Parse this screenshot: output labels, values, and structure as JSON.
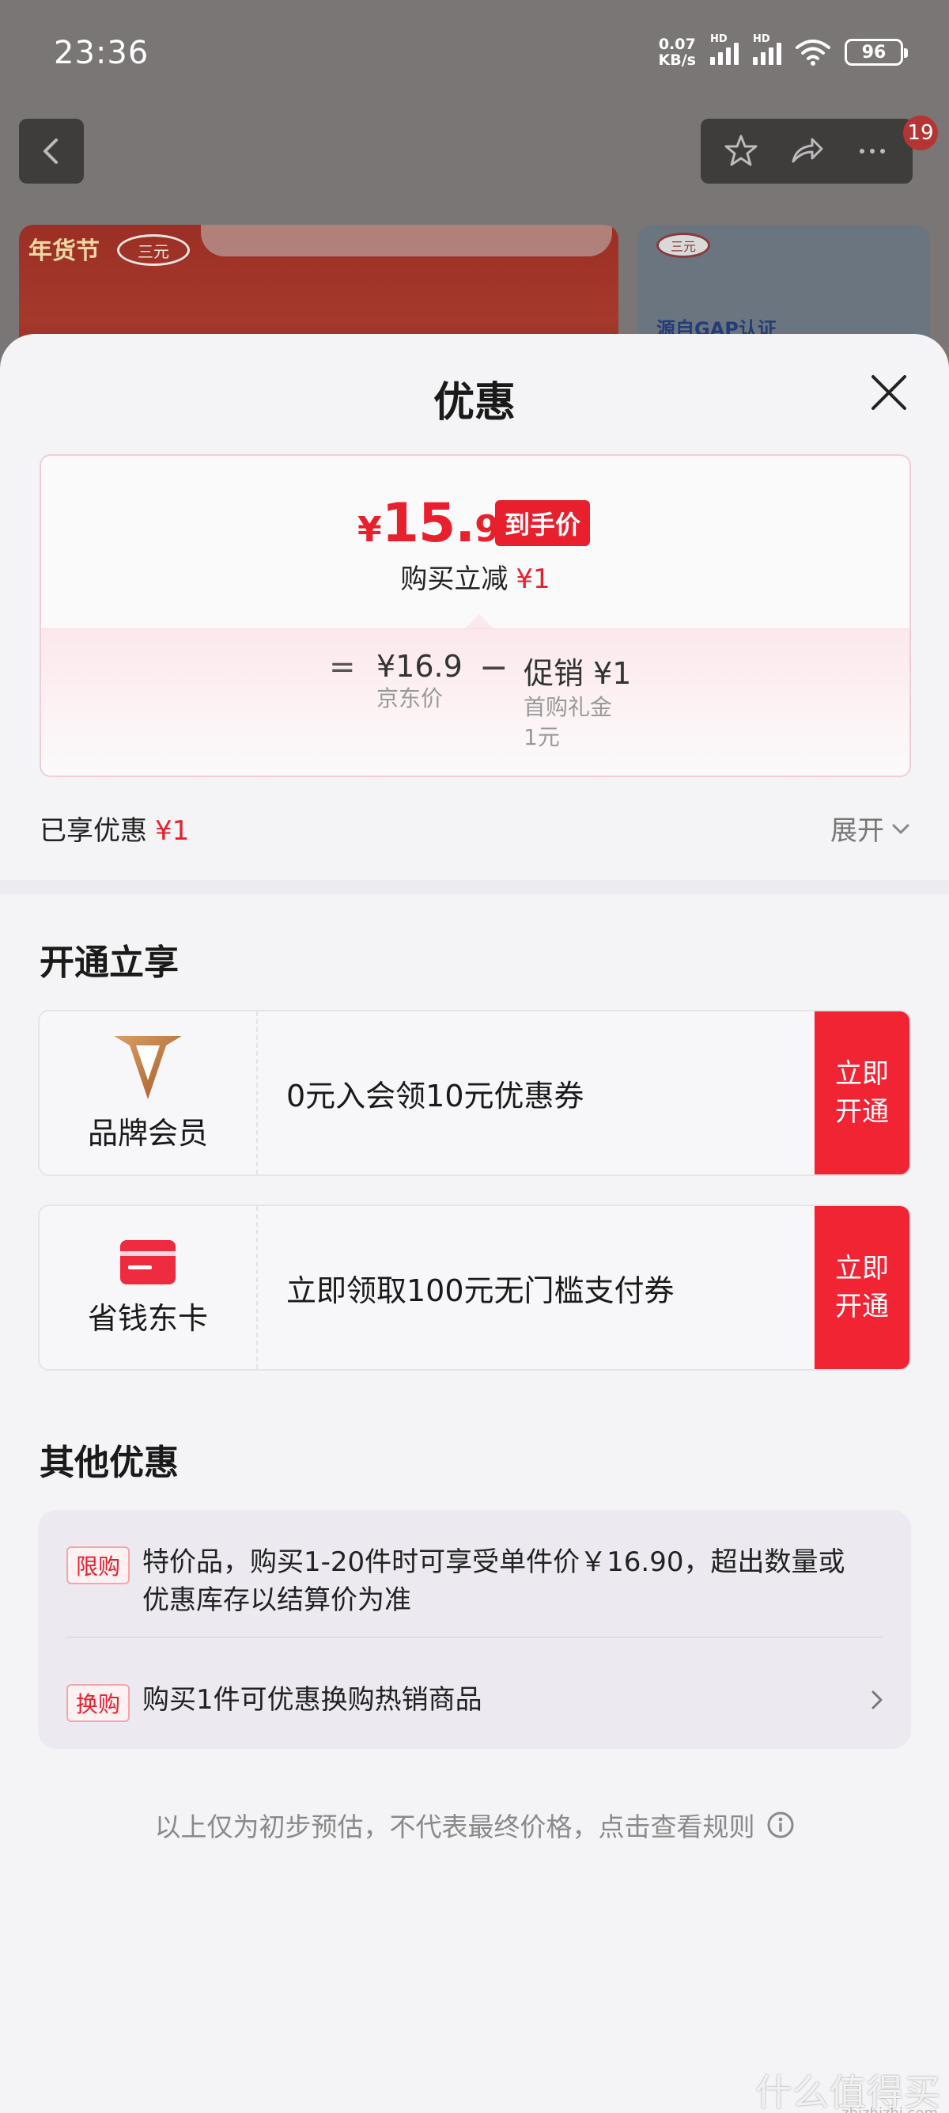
{
  "status_bar": {
    "time": "23:36",
    "net_speed_value": "0.07",
    "net_speed_unit": "KB/s",
    "hd_label": "HD",
    "battery": "96"
  },
  "background": {
    "badge_count": "19",
    "banner_tag": "年货节",
    "brand_logo": "三元",
    "banner_right_text": "源自GAP认证"
  },
  "sheet": {
    "title": "优惠",
    "price": {
      "currency": "¥",
      "integer": "15.",
      "decimal": "9",
      "tag": "到手价",
      "buy_reduce_label": "购买立减",
      "buy_reduce_amount": "¥1"
    },
    "formula": {
      "equals": "=",
      "jd_price_value": "¥16.9",
      "jd_price_label": "京东价",
      "minus": "−",
      "promo_value": "促销 ¥1",
      "promo_label": "首购礼金",
      "promo_sub": "1元"
    },
    "enjoyed_label": "已享优惠",
    "enjoyed_amount": "¥1",
    "expand_label": "展开",
    "open_section_title": "开通立享",
    "membership_cards": [
      {
        "name": "品牌会员",
        "desc": "0元入会领10元优惠券",
        "cta": "立即开通",
        "icon": "brand-v-icon"
      },
      {
        "name": "省钱东卡",
        "desc": "立即领取100元无门槛支付券",
        "cta": "立即开通",
        "icon": "red-card-icon"
      }
    ],
    "other_section_title": "其他优惠",
    "other_items": [
      {
        "chip": "限购",
        "text": "特价品，购买1-20件时可享受单件价￥16.90，超出数量或优惠库存以结算价为准"
      },
      {
        "chip": "换购",
        "text": "购买1件可优惠换购热销商品"
      }
    ],
    "disclaimer": "以上仅为初步预估，不代表最终价格，点击查看规则",
    "watermark": "什么值得买",
    "watermark_sub": "zhizhizhi.com"
  },
  "colors": {
    "accent_red": "#e8202e",
    "cta_red": "#f02433",
    "gold": "#b8702c"
  }
}
